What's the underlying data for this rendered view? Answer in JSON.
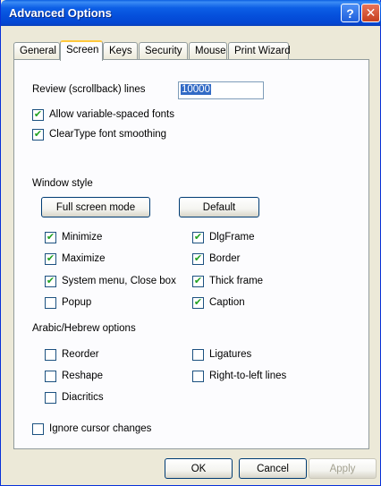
{
  "window": {
    "title": "Advanced Options",
    "help_glyph": "?",
    "close_glyph": "✕"
  },
  "tabs": [
    {
      "label": "General",
      "active": false
    },
    {
      "label": "Screen",
      "active": true
    },
    {
      "label": "Keys",
      "active": false
    },
    {
      "label": "Security",
      "active": false
    },
    {
      "label": "Mouse",
      "active": false
    },
    {
      "label": "Print Wizard",
      "active": false
    }
  ],
  "screen": {
    "review_label": "Review (scrollback) lines",
    "review_value": "10000",
    "variable_fonts": {
      "label": "Allow variable-spaced fonts",
      "checked": true
    },
    "cleartype": {
      "label": "ClearType font smoothing",
      "checked": true
    },
    "window_style_label": "Window style",
    "full_screen_button": "Full screen mode",
    "default_button": "Default",
    "left_styles": [
      {
        "label": "Minimize",
        "checked": true
      },
      {
        "label": "Maximize",
        "checked": true
      },
      {
        "label": "System menu, Close box",
        "checked": true
      },
      {
        "label": "Popup",
        "checked": false
      }
    ],
    "right_styles": [
      {
        "label": "DlgFrame",
        "checked": true
      },
      {
        "label": "Border",
        "checked": true
      },
      {
        "label": "Thick frame",
        "checked": true
      },
      {
        "label": "Caption",
        "checked": true
      }
    ],
    "arabic_label": "Arabic/Hebrew options",
    "arabic_left": [
      {
        "label": "Reorder",
        "checked": false
      },
      {
        "label": "Reshape",
        "checked": false
      },
      {
        "label": "Diacritics",
        "checked": false
      }
    ],
    "arabic_right": [
      {
        "label": "Ligatures",
        "checked": false
      },
      {
        "label": "Right-to-left lines",
        "checked": false
      }
    ],
    "ignore_cursor": {
      "label": "Ignore cursor changes",
      "checked": false
    }
  },
  "footer": {
    "ok": "OK",
    "cancel": "Cancel",
    "apply": "Apply"
  },
  "colors": {
    "titlebar": "#0550dc",
    "check": "#21a121",
    "dialog_bg": "#ece9d8"
  },
  "check_glyph": "✔"
}
